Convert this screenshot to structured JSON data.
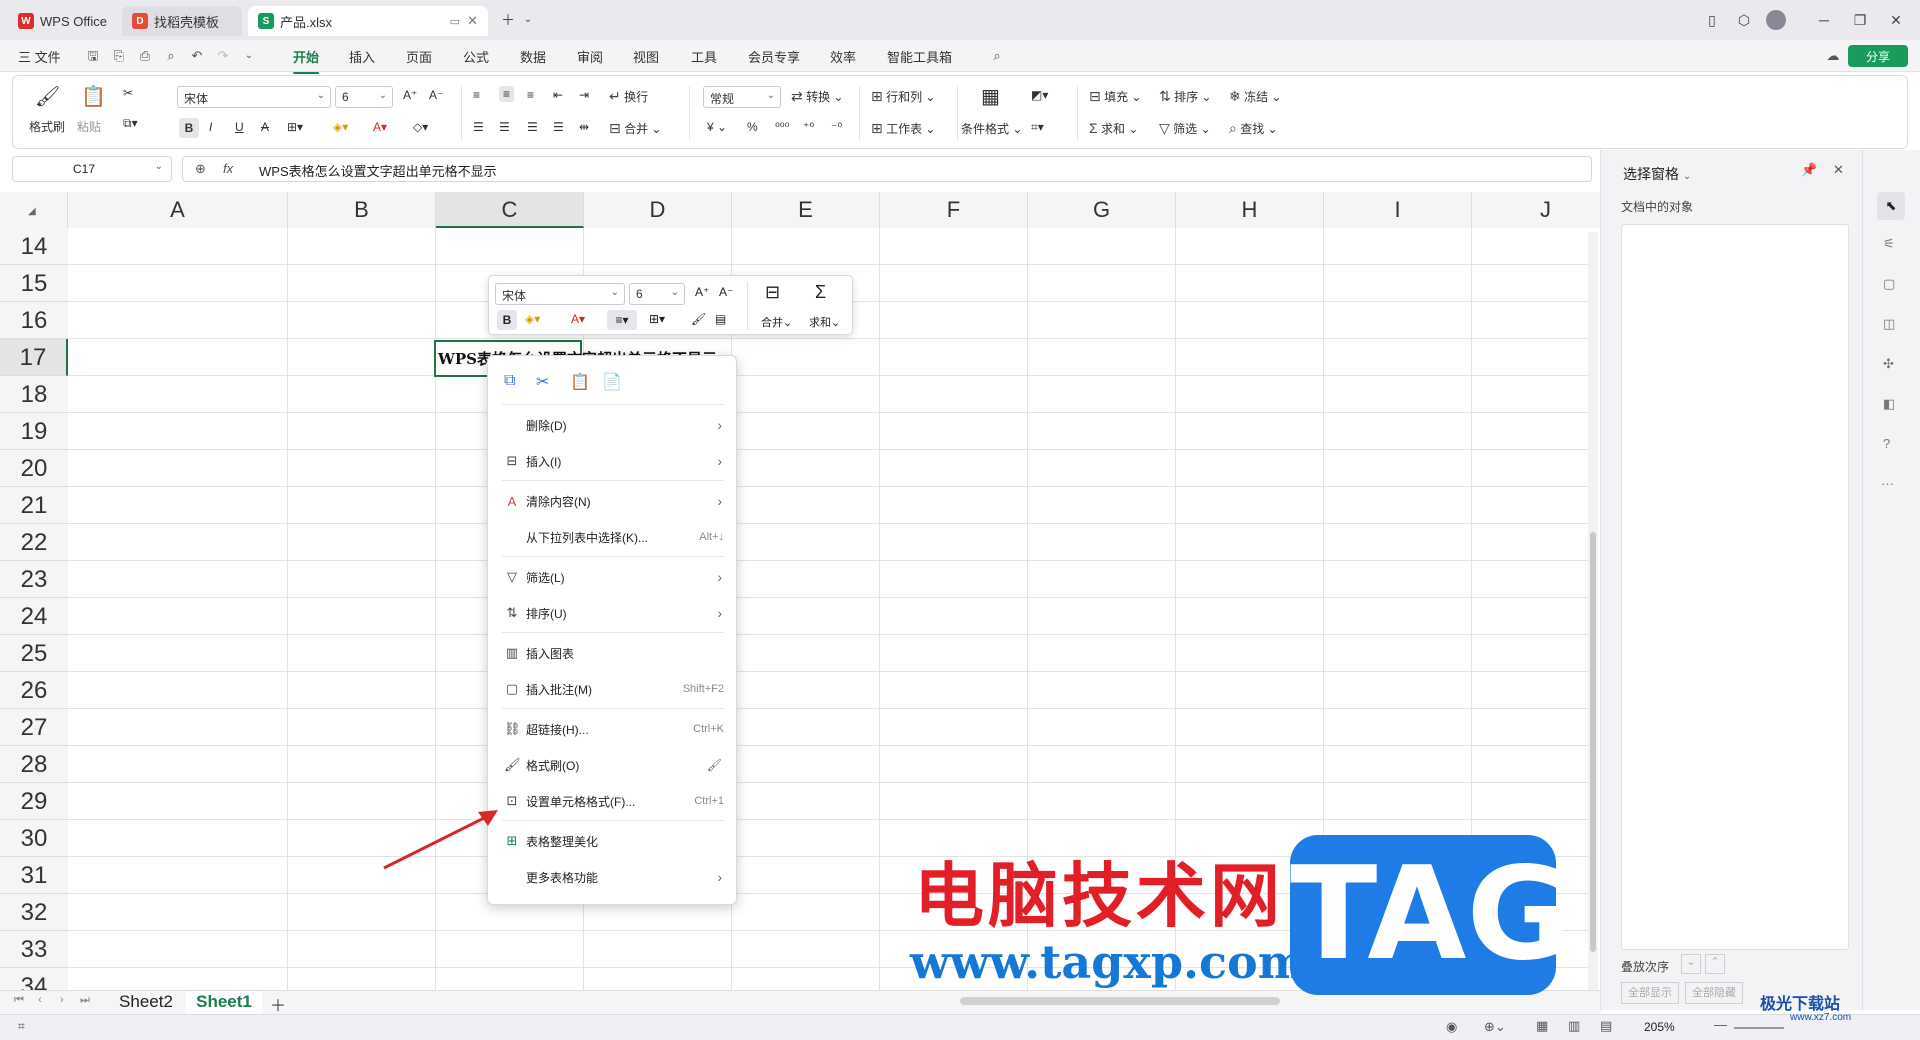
{
  "tabs": [
    {
      "label": "WPS Office"
    },
    {
      "label": "找稻壳模板"
    },
    {
      "label": "产品.xlsx"
    }
  ],
  "menu": {
    "file": "三 文件",
    "items": [
      "开始",
      "插入",
      "页面",
      "公式",
      "数据",
      "审阅",
      "视图",
      "工具",
      "会员专享",
      "效率",
      "智能工具箱"
    ],
    "share": "分享"
  },
  "ribbon": {
    "format_painter": "格式刷",
    "paste": "粘贴",
    "font": "宋体",
    "size": "6",
    "wrap": "换行",
    "merge": "合并",
    "number_format": "常规",
    "convert": "转换",
    "row_col": "行和列",
    "worksheet": "工作表",
    "cond_format": "条件格式",
    "fill": "填充",
    "sort": "排序",
    "freeze": "冻结",
    "sum": "求和",
    "filter": "筛选",
    "find": "查找"
  },
  "formula_bar": {
    "cell_ref": "C17",
    "fx": "fx",
    "content": "WPS表格怎么设置文字超出单元格不显示"
  },
  "grid": {
    "columns": [
      "A",
      "B",
      "C",
      "D",
      "E",
      "F",
      "G",
      "H",
      "I",
      "J"
    ],
    "rows": [
      "14",
      "15",
      "16",
      "17",
      "18",
      "19",
      "20",
      "21",
      "22",
      "23",
      "24",
      "25",
      "26",
      "27",
      "28",
      "29",
      "30",
      "31",
      "32",
      "33",
      "34"
    ],
    "cell_text": "WPS表格怎么设置文字超出单元格不显示"
  },
  "mini_toolbar": {
    "font": "宋体",
    "size": "6",
    "merge": "合并",
    "sum": "求和"
  },
  "context_menu": {
    "items": [
      {
        "label": "删除(D)",
        "shortcut": ""
      },
      {
        "label": "插入(I)",
        "shortcut": ""
      },
      {
        "label": "清除内容(N)",
        "shortcut": ""
      },
      {
        "label": "从下拉列表中选择(K)...",
        "shortcut": "Alt+↓"
      },
      {
        "label": "筛选(L)",
        "shortcut": ""
      },
      {
        "label": "排序(U)",
        "shortcut": ""
      },
      {
        "label": "插入图表",
        "shortcut": ""
      },
      {
        "label": "插入批注(M)",
        "shortcut": "Shift+F2"
      },
      {
        "label": "超链接(H)...",
        "shortcut": "Ctrl+K"
      },
      {
        "label": "格式刷(O)",
        "shortcut": ""
      },
      {
        "label": "设置单元格格式(F)...",
        "shortcut": "Ctrl+1"
      },
      {
        "label": "表格整理美化",
        "shortcut": ""
      },
      {
        "label": "更多表格功能",
        "shortcut": ""
      }
    ]
  },
  "sheets": [
    "Sheet2",
    "Sheet1"
  ],
  "right_pane": {
    "title": "选择窗格",
    "subtitle": "文档中的对象",
    "order": "叠放次序",
    "show_all": "全部显示",
    "hide_all": "全部隐藏"
  },
  "status": {
    "zoom": "205%"
  },
  "watermark": {
    "cn": "电脑技术网",
    "url": "www.tagxp.com",
    "tag": "TAG",
    "site": "极光下载站",
    "site_url": "www.xz7.com"
  },
  "colors": {
    "accent": "#1a7f4b",
    "share_button": "#1a9b5b",
    "selection": "#217346",
    "arrow": "#d42a2a"
  }
}
